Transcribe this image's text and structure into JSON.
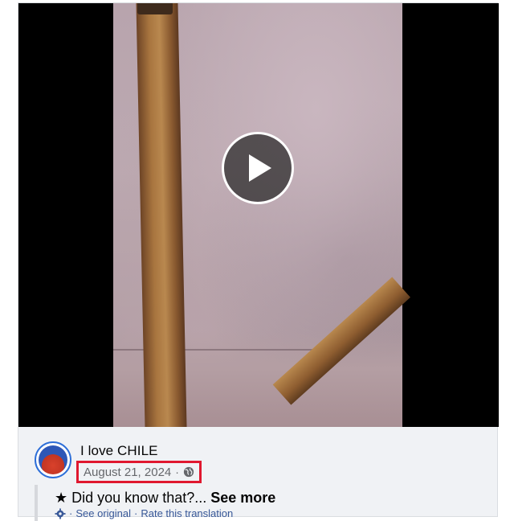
{
  "post": {
    "page_name": "I love CHILE",
    "date": "August 21, 2024",
    "separator": "·",
    "text_prefix": "★ Did you know that?...",
    "see_more": "See more",
    "translation": {
      "see_original": "See original",
      "separator": "·",
      "rate": "Rate this translation"
    }
  },
  "icons": {
    "play": "play-icon",
    "privacy": "globe-icon",
    "translation": "gear-icon"
  },
  "colors": {
    "highlight_box": "#e0182f",
    "link": "#385898",
    "muted_text": "#65676b"
  }
}
